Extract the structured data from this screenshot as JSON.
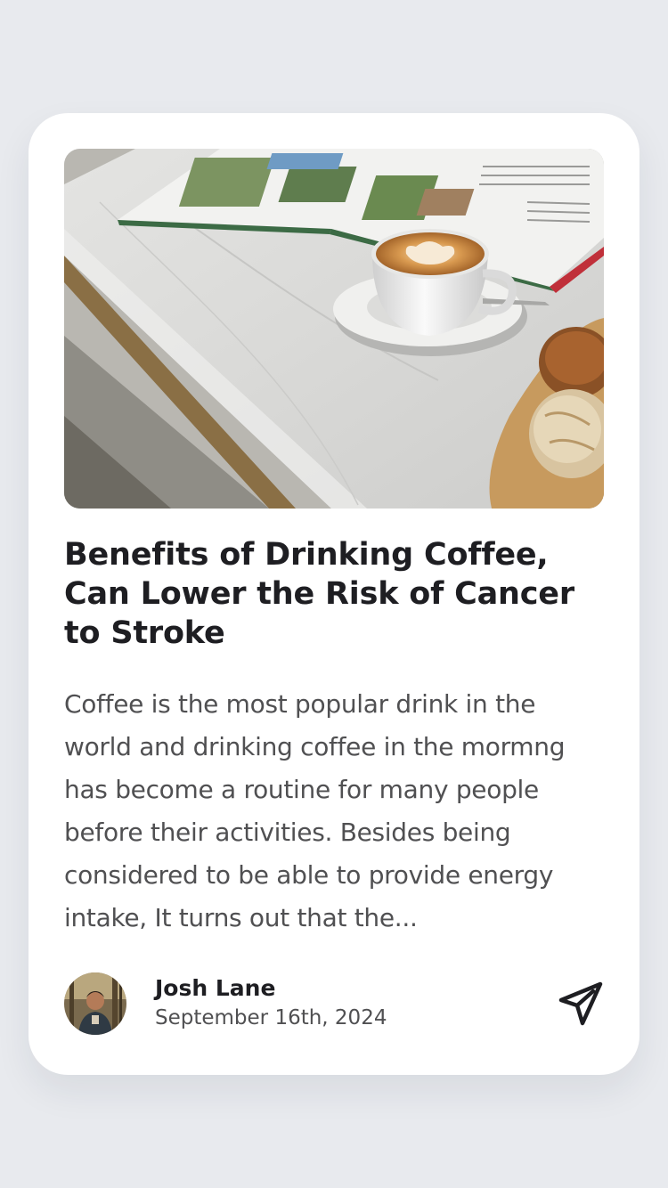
{
  "article": {
    "image_alt": "A cup of latte on a saucer beside an open magazine and pastries on a marble table",
    "title": "Benefits of Drinking Coffee, Can Lower the Risk of Cancer to Stroke",
    "excerpt": "Coffee is the most popular drink in the world and drinking coffee in the mormng has become a routine for many people before their activities. Besides being considered to be able to provide energy intake, It turns out that the..."
  },
  "author": {
    "name": "Josh Lane",
    "date": "September 16th, 2024"
  },
  "actions": {
    "share_icon": "paper-plane-icon"
  },
  "colors": {
    "background": "#e8eaee",
    "card": "#ffffff",
    "title": "#1e1e22",
    "body_text": "#505052"
  }
}
